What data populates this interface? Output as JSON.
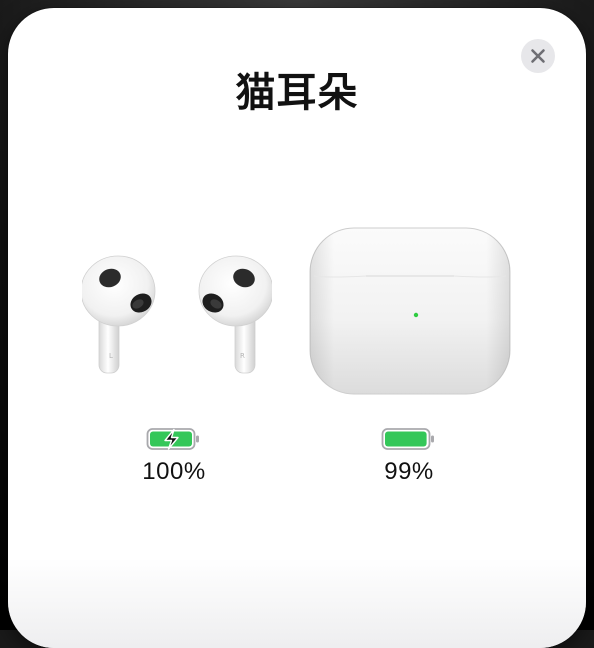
{
  "dialog": {
    "title": "猫耳朵",
    "close_icon": "close-icon"
  },
  "earbuds": {
    "icon": "airpods-earbuds",
    "left_marker": "L",
    "right_marker": "R",
    "battery": {
      "percent_label": "100%",
      "level": 1.0,
      "charging": true,
      "icon": "battery-charging-icon"
    }
  },
  "case": {
    "icon": "airpods-case",
    "battery": {
      "percent_label": "99%",
      "level": 0.99,
      "charging": false,
      "icon": "battery-icon"
    }
  },
  "colors": {
    "battery_fill": "#34c759",
    "status_light": "#2ecc40",
    "close_button_bg": "#e7e7ea",
    "close_glyph": "#6e6e73"
  }
}
